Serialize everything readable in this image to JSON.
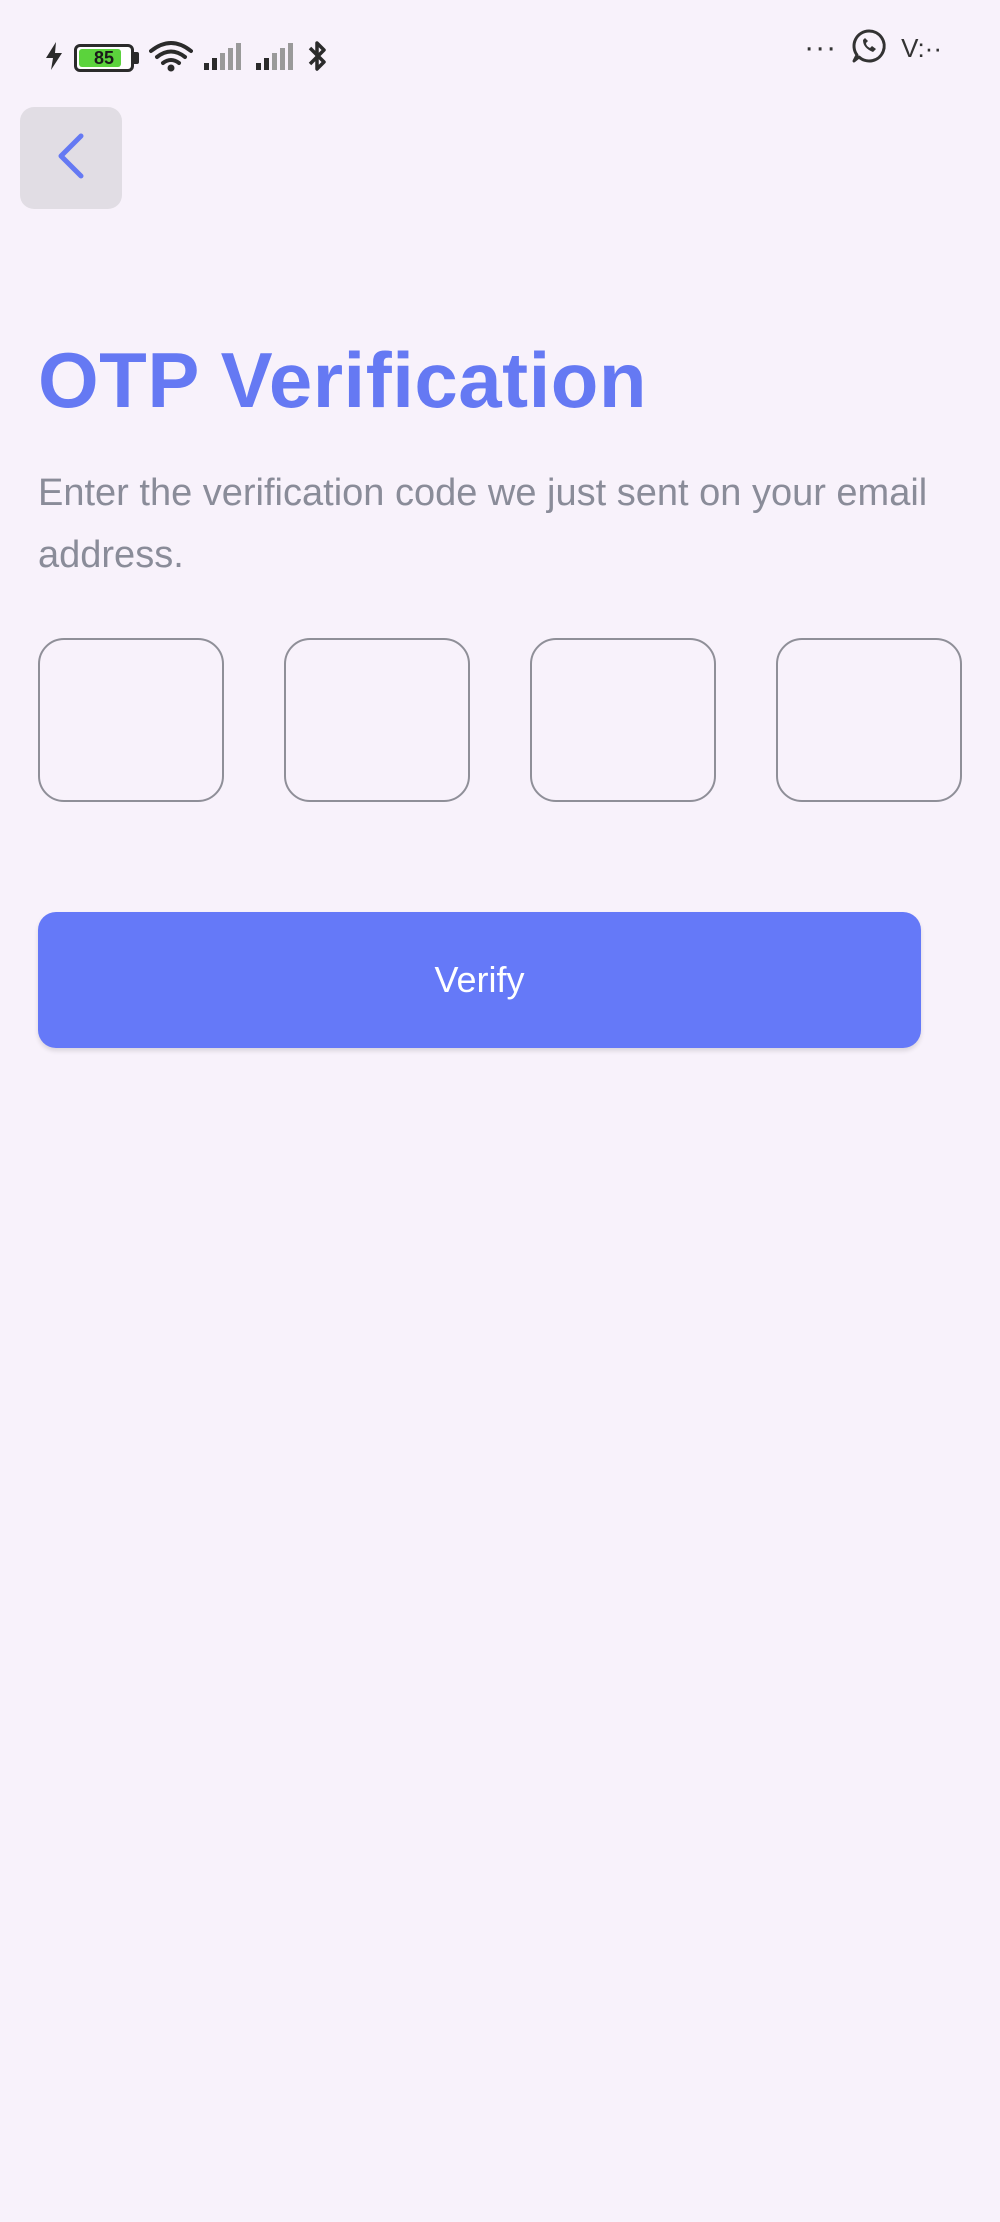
{
  "status_bar": {
    "battery_level": "85",
    "battery_percent": 85,
    "carrier_text": "V:··",
    "icons": [
      "charging-icon",
      "battery-icon",
      "wifi-icon",
      "signal-icon",
      "signal-icon",
      "bluetooth-icon",
      "more-dots-icon",
      "whatsapp-icon"
    ],
    "dots": "···"
  },
  "header": {
    "back_icon": "chevron-left-icon"
  },
  "main": {
    "title": "OTP Verification",
    "subtitle": "Enter the verification code we just sent on your email address.",
    "otp_digits": [
      "",
      "",
      "",
      ""
    ],
    "verify_label": "Verify"
  },
  "colors": {
    "background": "#f8f2fb",
    "accent": "#6579f3",
    "button": "#6579f8",
    "subtitle_text": "#8a8c99",
    "box_border": "#8f8f98",
    "back_button_bg": "#e1dde4"
  }
}
